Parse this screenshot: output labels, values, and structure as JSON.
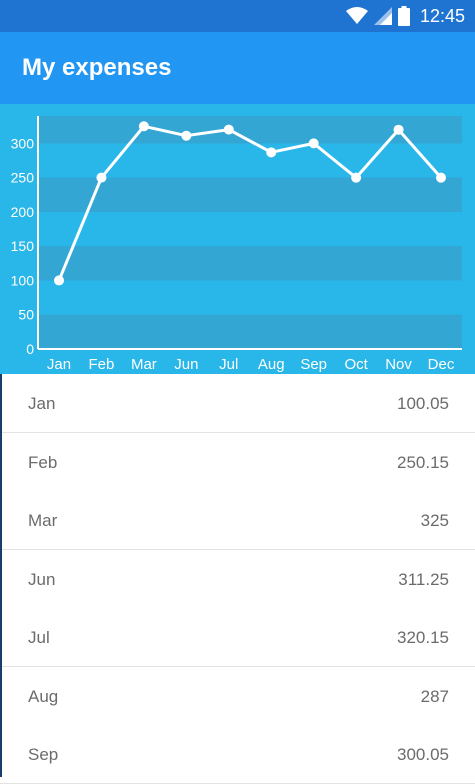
{
  "statusbar": {
    "time": "12:45"
  },
  "appbar": {
    "title": "My expenses"
  },
  "colors": {
    "primary_dark": "#1f74d2",
    "primary": "#2196f3",
    "chart_bg": "#29b6e8",
    "chart_band": "#33a6d3",
    "line": "#ffffff"
  },
  "icons": [
    "wifi-icon",
    "signal-icon",
    "battery-icon"
  ],
  "chart_data": {
    "type": "line",
    "categories": [
      "Jan",
      "Feb",
      "Mar",
      "Jun",
      "Jul",
      "Aug",
      "Sep",
      "Oct",
      "Nov",
      "Dec"
    ],
    "series": [
      {
        "values": [
          100.05,
          250.15,
          325,
          311.25,
          320.15,
          287,
          300.05,
          250,
          320,
          250
        ]
      }
    ],
    "yticks": [
      "0",
      "50",
      "100",
      "150",
      "200",
      "250",
      "300"
    ],
    "ylim": [
      0,
      340
    ],
    "grid": "alternating horizontal bands",
    "legend": "none"
  },
  "expenses": [
    {
      "month": "Jan",
      "amount": "100.05"
    },
    {
      "month": "Feb",
      "amount": "250.15"
    },
    {
      "month": "Mar",
      "amount": "325"
    },
    {
      "month": "Jun",
      "amount": "311.25"
    },
    {
      "month": "Jul",
      "amount": "320.15"
    },
    {
      "month": "Aug",
      "amount": "287"
    },
    {
      "month": "Sep",
      "amount": "300.05"
    }
  ]
}
